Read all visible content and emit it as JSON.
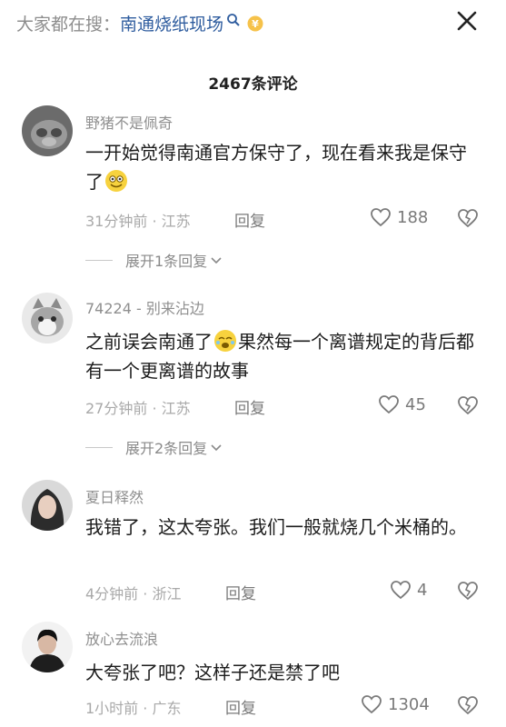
{
  "header": {
    "search_prefix": "大家都在搜：",
    "search_keyword": "南通烧纸现场",
    "close_label": "×"
  },
  "comment_count_title": "2467条评论",
  "comments": [
    {
      "username": "野猪不是佩奇",
      "text_before": "一开始觉得南通官方保守了，现在看来我是保守了",
      "text_after": "",
      "time": "31分钟前",
      "location": "江苏",
      "reply_label": "回复",
      "likes": "188",
      "expand_label": "展开1条回复"
    },
    {
      "username": "74224 - 别来沾边",
      "text_before": "之前误会南通了",
      "text_after": "果然每一个离谱规定的背后都有一个更离谱的故事",
      "time": "27分钟前",
      "location": "江苏",
      "reply_label": "回复",
      "likes": "45",
      "expand_label": "展开2条回复"
    },
    {
      "username": "夏日释然",
      "text_before": "我错了，这太夸张。我们一般就烧几个米桶的。",
      "text_after": "",
      "time": "4分钟前",
      "location": "浙江",
      "reply_label": "回复",
      "likes": "4"
    },
    {
      "username": "放心去流浪",
      "text_before": "大夸张了吧？这样子还是禁了吧",
      "text_after": "",
      "time": "1小时前",
      "location": "广东",
      "reply_label": "回复",
      "likes": "1304"
    }
  ],
  "colors": {
    "keyword_blue": "#2f5d9f",
    "meta_gray": "#a9a9a9",
    "text": "#1c1c1c"
  }
}
